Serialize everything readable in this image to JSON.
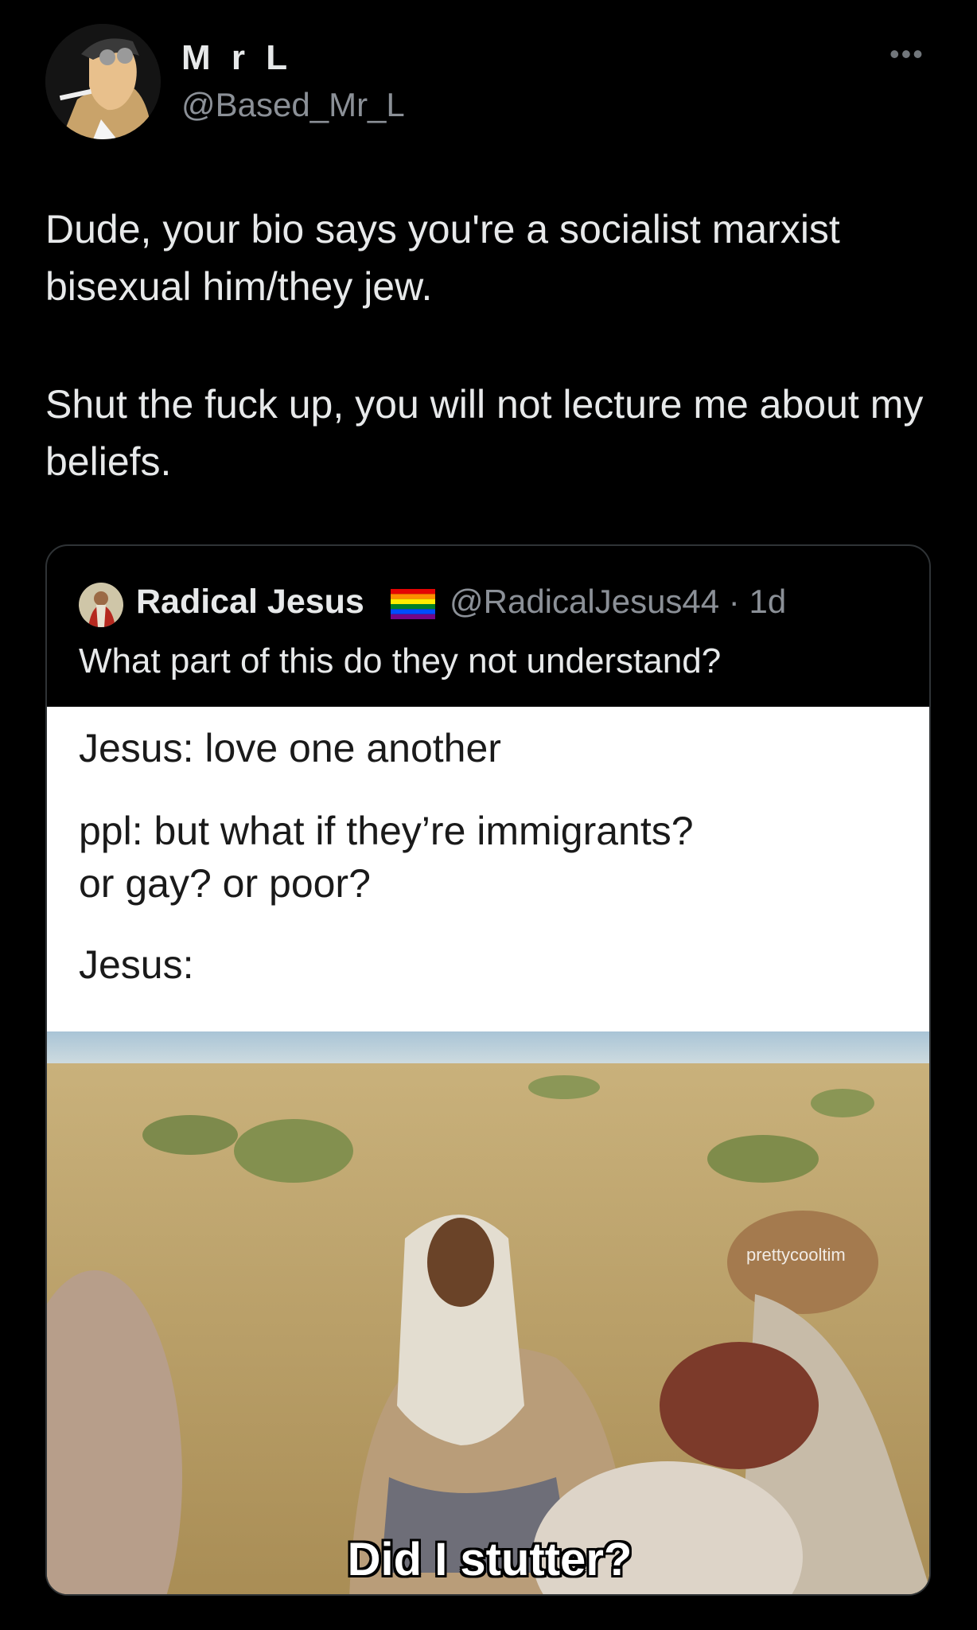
{
  "author": {
    "name": "M r L",
    "handle": "@Based_Mr_L",
    "avatar_icon": "cartoon-man-avatar"
  },
  "menu_icon": "more-horizontal-icon",
  "more_glyph": "•••",
  "tweet": {
    "paragraph1": "Dude, your bio says you're a socialist marxist bisexual him/they jew.",
    "paragraph2": "Shut the fuck up, you will not lecture me about my beliefs."
  },
  "quoted": {
    "name": "Radical Jesus",
    "flag_icon": "rainbow-flag-icon",
    "handle_time": "@RadicalJesus44 · 1d",
    "text": "What part of this do they not understand?",
    "meme": {
      "line1": "Jesus: love one another",
      "line2": "ppl: but what if they’re immigrants?",
      "line3": "or gay? or poor?",
      "line4": "Jesus:",
      "caption": "Did I stutter?",
      "watermark": "prettycooltim"
    }
  },
  "colors": {
    "background": "#000000",
    "text": "#e7e9ea",
    "secondary": "#8b9097",
    "border": "#2f3336"
  }
}
